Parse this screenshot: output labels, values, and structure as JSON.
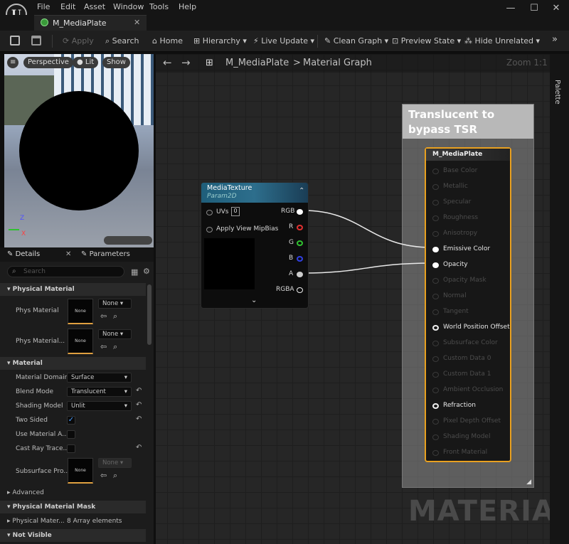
{
  "menu": [
    "File",
    "Edit",
    "Asset",
    "Window",
    "Tools",
    "Help"
  ],
  "tab": {
    "title": "M_MediaPlate"
  },
  "toolbar": {
    "apply": "Apply",
    "search": "Search",
    "home": "Home",
    "hierarchy": "Hierarchy",
    "live_update": "Live Update",
    "clean_graph": "Clean Graph",
    "preview_state": "Preview State",
    "hide_unrelated": "Hide Unrelated"
  },
  "viewport": {
    "perspective": "Perspective",
    "lit": "Lit",
    "show": "Show",
    "axis_z": "Z",
    "axis_x": "X"
  },
  "details": {
    "tab_details": "Details",
    "tab_parameters": "Parameters",
    "search_placeholder": "Search",
    "sections": {
      "physical_material": "Physical Material",
      "material": "Material",
      "advanced": "Advanced",
      "physical_material_mask": "Physical Material Mask",
      "not_visible": "Not Visible"
    },
    "rows": {
      "phys_material": "Phys Material",
      "phys_material2": "Phys Material...",
      "thumb_none": "None",
      "dd_none": "None",
      "material_domain": "Material Domain",
      "material_domain_value": "Surface",
      "blend_mode": "Blend Mode",
      "blend_mode_value": "Translucent",
      "shading_model": "Shading Model",
      "shading_model_value": "Unlit",
      "two_sided": "Two Sided",
      "use_material_a": "Use Material A...",
      "cast_ray_trace": "Cast Ray Trace...",
      "subsurface_pro": "Subsurface Pro...",
      "physical_mater": "Physical Mater...",
      "array_elements": "8 Array elements"
    }
  },
  "graph": {
    "breadcrumb_root": "M_MediaPlate",
    "breadcrumb_sep": ">",
    "breadcrumb_leaf": "Material Graph",
    "zoom": "Zoom 1:1",
    "comment": "Translucent to bypass TSR",
    "watermark": "MATERIAL",
    "media_node": {
      "title": "MediaTexture",
      "subtitle": "Param2D",
      "uvs": "UVs",
      "uvs_value": "0",
      "mipbias": "Apply View MipBias",
      "outputs": [
        "RGB",
        "R",
        "G",
        "B",
        "A",
        "RGBA"
      ]
    },
    "result_node": {
      "title": "M_MediaPlate",
      "inputs": [
        "Base Color",
        "Metallic",
        "Specular",
        "Roughness",
        "Anisotropy",
        "Emissive Color",
        "Opacity",
        "Opacity Mask",
        "Normal",
        "Tangent",
        "World Position Offset",
        "Subsurface Color",
        "Custom Data 0",
        "Custom Data 1",
        "Ambient Occlusion",
        "Refraction",
        "Pixel Depth Offset",
        "Shading Model",
        "Front Material"
      ],
      "active": [
        5,
        6,
        10,
        15
      ]
    }
  },
  "palette": "Palette",
  "colors": {
    "accent": "#e8a020",
    "node_header": "#2d6e8c",
    "pin_r": "#e03030",
    "pin_g": "#30c030",
    "pin_b": "#3040e0"
  }
}
